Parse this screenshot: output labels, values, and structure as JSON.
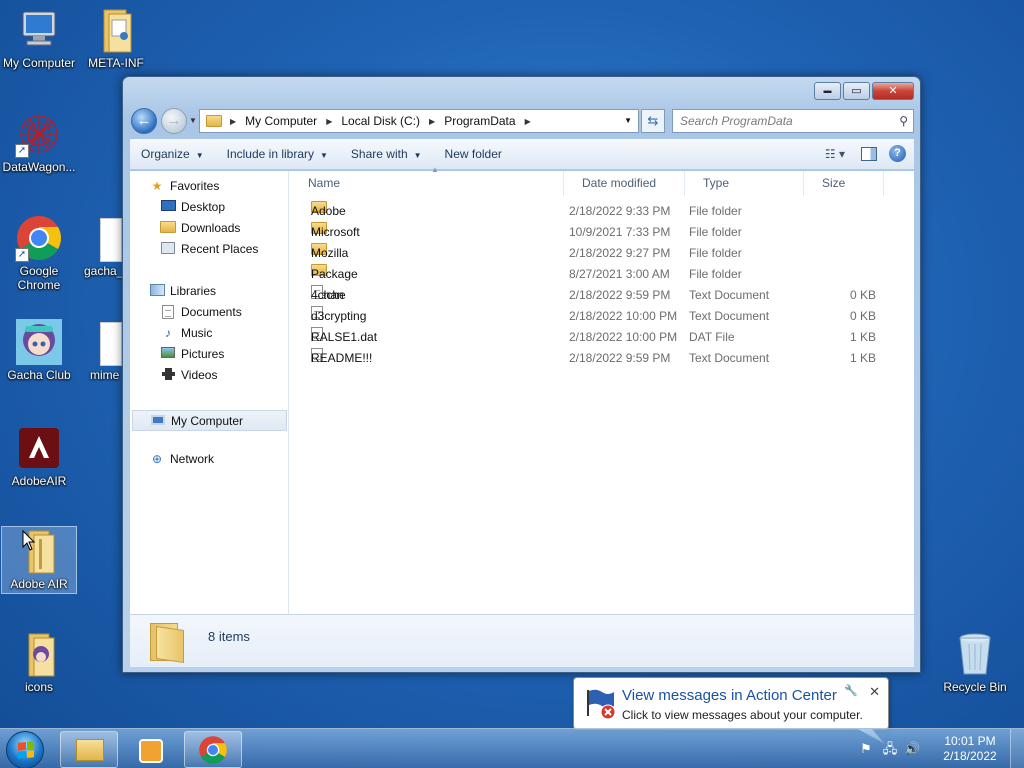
{
  "desktop": {
    "icons": [
      {
        "label": "My Computer"
      },
      {
        "label": "META-INF"
      },
      {
        "label": "DataWagon..."
      },
      {
        "label": "Google Chrome"
      },
      {
        "label": "gacha_"
      },
      {
        "label": "Gacha Club"
      },
      {
        "label": "mime"
      },
      {
        "label": "AdobeAIR"
      },
      {
        "label": "Adobe AIR"
      },
      {
        "label": "icons"
      },
      {
        "label": "Recycle Bin"
      }
    ]
  },
  "explorer": {
    "window_buttons": {
      "minimize": "▬",
      "maximize": "▭",
      "close": "✕"
    },
    "breadcrumb": [
      "My Computer",
      "Local Disk (C:)",
      "ProgramData"
    ],
    "search_placeholder": "Search ProgramData",
    "toolbar": {
      "organize": "Organize",
      "include_in_library": "Include in library",
      "share_with": "Share with",
      "new_folder": "New folder"
    },
    "nav": {
      "favorites": "Favorites",
      "desktop": "Desktop",
      "downloads": "Downloads",
      "recent_places": "Recent Places",
      "libraries": "Libraries",
      "documents": "Documents",
      "music": "Music",
      "pictures": "Pictures",
      "videos": "Videos",
      "my_computer": "My Computer",
      "network": "Network"
    },
    "columns": {
      "name": "Name",
      "date_modified": "Date modified",
      "type": "Type",
      "size": "Size"
    },
    "files": [
      {
        "name": "Adobe",
        "date": "2/18/2022 9:33 PM",
        "type": "File folder",
        "size": "",
        "icon": "folder"
      },
      {
        "name": "Microsoft",
        "date": "10/9/2021 7:33 PM",
        "type": "File folder",
        "size": "",
        "icon": "folder"
      },
      {
        "name": "Mozilla",
        "date": "2/18/2022 9:27 PM",
        "type": "File folder",
        "size": "",
        "icon": "folder"
      },
      {
        "name": "Package Cache",
        "date": "8/27/2021 3:00 AM",
        "type": "File folder",
        "size": "",
        "icon": "folder"
      },
      {
        "name": "4chan",
        "date": "2/18/2022 9:59 PM",
        "type": "Text Document",
        "size": "0 KB",
        "icon": "document"
      },
      {
        "name": "d3crypting",
        "date": "2/18/2022 10:00 PM",
        "type": "Text Document",
        "size": "0 KB",
        "icon": "document"
      },
      {
        "name": "RALSE1.dat",
        "date": "2/18/2022 10:00 PM",
        "type": "DAT File",
        "size": "1 KB",
        "icon": "document"
      },
      {
        "name": "README!!!",
        "date": "2/18/2022 9:59 PM",
        "type": "Text Document",
        "size": "1 KB",
        "icon": "document"
      }
    ],
    "item_count": "8 items"
  },
  "balloon": {
    "title": "View messages in Action Center",
    "text": "Click to view messages about your computer."
  },
  "taskbar": {
    "time": "10:01 PM",
    "date": "2/18/2022"
  },
  "colors": {
    "accent": "#1a52a0",
    "desktop": "#1f63b4"
  }
}
